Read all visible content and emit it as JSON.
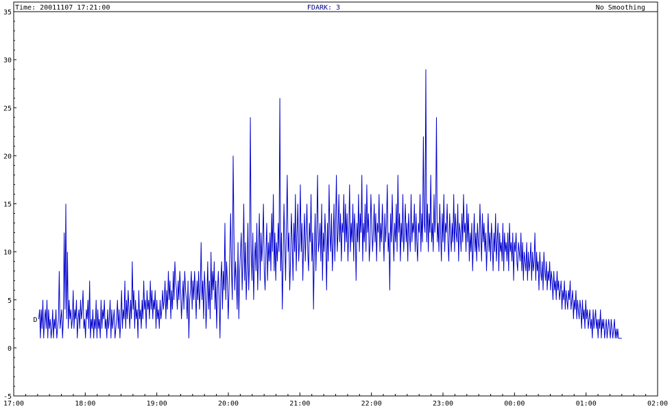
{
  "header": {
    "time_label": "Time: 20011107 17:21:00",
    "fdark_label": "FDARK: 3",
    "smoothing_label": "No Smoothing"
  },
  "series_marker": "D",
  "colors": {
    "line": "#0000cc",
    "axis": "#000000",
    "header_accent": "#00008b"
  },
  "chart_data": {
    "type": "line",
    "title": "",
    "xlabel": "",
    "ylabel": "",
    "xlim": [
      "17:00",
      "02:00"
    ],
    "ylim": [
      -5,
      35
    ],
    "grid": false,
    "x_tick_labels": [
      "17:00",
      "18:00",
      "19:00",
      "20:00",
      "21:00",
      "22:00",
      "23:00",
      "00:00",
      "01:00",
      "02:00"
    ],
    "y_tick_labels": [
      "-5",
      "0",
      "5",
      "10",
      "15",
      "20",
      "25",
      "30",
      "35"
    ],
    "x_time_start_hour": 17.35,
    "x_time_end_hour": 25.5,
    "series": [
      {
        "values": [
          3,
          4,
          1,
          4,
          2,
          5,
          1,
          3,
          4,
          2,
          5,
          1,
          4,
          2,
          3,
          1,
          2,
          4,
          1,
          3,
          2,
          4,
          1,
          2,
          3,
          8,
          2,
          3,
          4,
          1,
          3,
          12,
          4,
          15,
          3,
          10,
          2,
          5,
          3,
          4,
          2,
          3,
          6,
          2,
          4,
          3,
          5,
          1,
          3,
          4,
          2,
          5,
          3,
          4,
          6,
          2,
          3,
          1,
          4,
          3,
          5,
          2,
          7,
          1,
          3,
          2,
          4,
          1,
          3,
          2,
          5,
          1,
          4,
          2,
          3,
          1,
          5,
          2,
          4,
          3,
          5,
          2,
          3,
          1,
          4,
          2,
          3,
          5,
          1,
          4,
          2,
          3,
          4,
          1,
          2,
          3,
          5,
          2,
          4,
          1,
          3,
          6,
          2,
          4,
          3,
          7,
          2,
          5,
          3,
          6,
          4,
          2,
          5,
          3,
          9,
          4,
          6,
          2,
          5,
          3,
          4,
          1,
          6,
          3,
          4,
          2,
          5,
          3,
          7,
          4,
          5,
          2,
          6,
          4,
          5,
          3,
          7,
          4,
          6,
          3,
          5,
          4,
          6,
          2,
          5,
          3,
          4,
          2,
          5,
          3,
          4,
          6,
          4,
          5,
          7,
          3,
          6,
          4,
          8,
          5,
          7,
          3,
          6,
          4,
          8,
          5,
          9,
          7,
          6,
          4,
          7,
          5,
          8,
          6,
          3,
          5,
          7,
          4,
          8,
          6,
          5,
          3,
          7,
          1,
          5,
          6,
          8,
          4,
          7,
          5,
          8,
          6,
          3,
          7,
          5,
          8,
          4,
          6,
          11,
          5,
          7,
          3,
          8,
          6,
          2,
          5,
          9,
          4,
          7,
          3,
          10,
          5,
          8,
          6,
          9,
          4,
          7,
          2,
          6,
          8,
          5,
          1,
          7,
          9,
          4,
          8,
          6,
          13,
          5,
          9,
          7,
          3,
          6,
          10,
          14,
          8,
          5,
          20,
          12,
          6,
          9,
          7,
          4,
          11,
          3,
          8,
          10,
          12,
          6,
          9,
          15,
          7,
          11,
          5,
          8,
          13,
          6,
          9,
          24,
          10,
          7,
          12,
          5,
          9,
          11,
          8,
          13,
          6,
          10,
          14,
          7,
          12,
          9,
          11,
          15,
          8,
          6,
          10,
          13,
          7,
          11,
          9,
          12,
          8,
          14,
          10,
          16,
          8,
          12,
          7,
          11,
          9,
          13,
          10,
          26,
          8,
          12,
          4,
          9,
          15,
          11,
          7,
          13,
          18,
          10,
          12,
          6,
          9,
          14,
          11,
          7,
          13,
          10,
          16,
          8,
          12,
          15,
          9,
          11,
          17,
          10,
          13,
          7,
          11,
          14,
          9,
          12,
          15,
          10,
          8,
          13,
          11,
          16,
          9,
          12,
          4,
          10,
          14,
          8,
          12,
          18,
          10,
          11,
          13,
          9,
          15,
          7,
          12,
          10,
          14,
          11,
          6,
          13,
          9,
          17,
          12,
          10,
          14,
          8,
          11,
          15,
          9,
          13,
          18,
          10,
          12,
          16,
          11,
          14,
          9,
          13,
          12,
          16,
          10,
          15,
          11,
          14,
          9,
          12,
          17,
          10,
          13,
          11,
          15,
          9,
          14,
          12,
          7,
          13,
          11,
          16,
          10,
          14,
          12,
          18,
          9,
          13,
          11,
          15,
          10,
          17,
          12,
          14,
          9,
          11,
          16,
          13,
          10,
          12,
          15,
          11,
          14,
          9,
          13,
          12,
          16,
          10,
          13,
          11,
          15,
          12,
          9,
          14,
          11,
          13,
          17,
          10,
          12,
          6,
          14,
          11,
          16,
          12,
          9,
          13,
          11,
          15,
          10,
          18,
          12,
          14,
          9,
          13,
          11,
          16,
          10,
          12,
          15,
          11,
          13,
          9,
          14,
          12,
          10,
          16,
          11,
          13,
          12,
          15,
          10,
          14,
          11,
          9,
          13,
          12,
          16,
          10,
          14,
          11,
          22,
          13,
          12,
          29,
          11,
          15,
          10,
          14,
          12,
          18,
          11,
          13,
          10,
          16,
          12,
          14,
          24,
          11,
          13,
          10,
          15,
          12,
          9,
          14,
          11,
          16,
          10,
          13,
          12,
          15,
          11,
          9,
          14,
          12,
          10,
          13,
          11,
          16,
          10,
          14,
          12,
          11,
          15,
          9,
          13,
          12,
          10,
          14,
          11,
          16,
          12,
          13,
          10,
          15,
          11,
          14,
          9,
          12,
          10,
          13,
          8,
          11,
          14,
          10,
          12,
          9,
          13,
          11,
          10,
          15,
          12,
          9,
          14,
          11,
          13,
          10,
          12,
          8,
          11,
          14,
          10,
          12,
          9,
          13,
          11,
          8,
          12,
          10,
          14,
          9,
          11,
          13,
          8,
          12,
          10,
          11,
          9,
          13,
          8,
          12,
          10,
          11,
          9,
          12,
          8,
          13,
          10,
          11,
          9,
          12,
          7,
          11,
          10,
          12,
          9,
          8,
          11,
          10,
          9,
          12,
          8,
          11,
          7,
          10,
          9,
          8,
          11,
          7,
          10,
          8,
          9,
          11,
          7,
          10,
          8,
          9,
          12,
          7,
          10,
          8,
          9,
          6,
          10,
          8,
          7,
          9,
          6,
          10,
          8,
          7,
          9,
          6,
          8,
          7,
          9,
          6,
          8,
          7,
          5,
          8,
          6,
          7,
          5,
          8,
          6,
          7,
          5,
          6,
          7,
          4,
          6,
          5,
          7,
          4,
          6,
          5,
          4,
          6,
          5,
          7,
          4,
          5,
          6,
          3,
          5,
          4,
          6,
          3,
          5,
          4,
          3,
          5,
          4,
          2,
          5,
          3,
          4,
          2,
          5,
          3,
          4,
          2,
          3,
          4,
          2,
          3,
          1,
          4,
          2,
          3,
          4,
          2,
          3,
          1,
          3,
          2,
          4,
          1,
          3,
          2,
          3,
          1,
          2,
          3,
          1,
          2,
          3,
          2,
          1,
          3,
          2,
          1,
          2,
          3,
          1,
          2,
          1,
          2,
          1,
          1,
          1,
          1,
          1
        ]
      }
    ]
  }
}
